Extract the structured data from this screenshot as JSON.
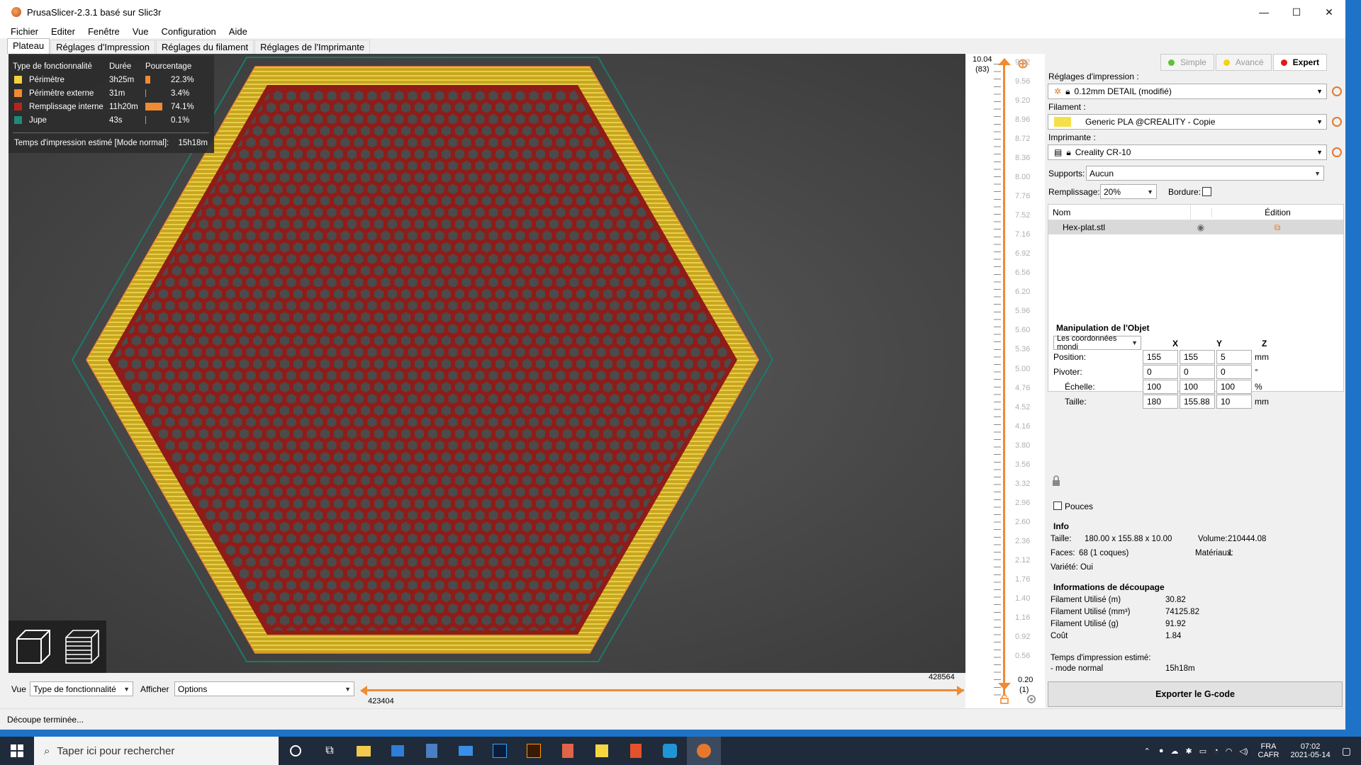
{
  "window": {
    "title": "PrusaSlicer-2.3.1 basé sur Slic3r",
    "controls": {
      "minimize": "—",
      "maximize": "☐",
      "close": "✕"
    }
  },
  "menu": [
    "Fichier",
    "Editer",
    "Fenêtre",
    "Vue",
    "Configuration",
    "Aide"
  ],
  "tabs": [
    "Plateau",
    "Réglages d'Impression",
    "Réglages du filament",
    "Réglages de l'Imprimante"
  ],
  "legend": {
    "headers": {
      "type": "Type de fonctionnalité",
      "duration": "Durée",
      "percent": "Pourcentage"
    },
    "rows": [
      {
        "name": "Périmètre",
        "duration": "3h25m",
        "percent": "22.3%",
        "fraction": 0.223,
        "color": "#f5d13b"
      },
      {
        "name": "Périmètre externe",
        "duration": "31m",
        "percent": "3.4%",
        "fraction": 0.034,
        "color": "#f08a33"
      },
      {
        "name": "Remplissage interne",
        "duration": "11h20m",
        "percent": "74.1%",
        "fraction": 0.741,
        "color": "#b3261e"
      },
      {
        "name": "Jupe",
        "duration": "43s",
        "percent": "0.1%",
        "fraction": 0.001,
        "color": "#1f8a7a"
      }
    ],
    "time_label": "Temps d'impression estimé [Mode normal]:",
    "time_value": "15h18m",
    "bar_color": "#f08a33"
  },
  "view_toolbar": {
    "icon_3d": "cube-icon",
    "icon_layers": "layers-icon"
  },
  "vertical_slider": {
    "top_value": "10.04",
    "top_layer": "(83)",
    "bottom_value": "0.20",
    "bottom_layer": "(1)",
    "ticks": [
      "9.92",
      "9.56",
      "9.20",
      "8.96",
      "8.72",
      "8.36",
      "8.00",
      "7.76",
      "7.52",
      "7.16",
      "6.92",
      "6.56",
      "6.20",
      "5.96",
      "5.60",
      "5.36",
      "5.00",
      "4.76",
      "4.52",
      "4.16",
      "3.80",
      "3.56",
      "3.32",
      "2.96",
      "2.60",
      "2.36",
      "2.12",
      "1.76",
      "1.40",
      "1.16",
      "0.92",
      "0.56"
    ],
    "accent": "#f08a33"
  },
  "bottom_bar": {
    "view_label": "Vue",
    "view_value": "Type de fonctionnalité",
    "show_label": "Afficher",
    "show_value": "Options",
    "slider_left": "423404",
    "slider_right": "428564"
  },
  "status": "Découpe terminée...",
  "sidebar": {
    "modes": [
      {
        "label": "Simple",
        "color": "#5fc234"
      },
      {
        "label": "Avancé",
        "color": "#f5d30e"
      },
      {
        "label": "Expert",
        "color": "#e01b1b"
      }
    ],
    "print_settings_label": "Réglages d'impression :",
    "print_settings_value": "0.12mm DETAIL (modifié)",
    "filament_label": "Filament :",
    "filament_value": "Generic PLA @CREALITY - Copie",
    "filament_color": "#f5e04a",
    "printer_label": "Imprimante :",
    "printer_value": "Creality CR-10",
    "supports_label": "Supports:",
    "supports_value": "Aucun",
    "infill_label": "Remplissage:",
    "infill_value": "20%",
    "brim_label": "Bordure:",
    "objects": {
      "col_name": "Nom",
      "col_edit": "Édition",
      "items": [
        {
          "name": "Hex-plat.stl"
        }
      ]
    },
    "manip": {
      "title": "Manipulation de l'Objet",
      "coord_mode": "Les coordonnées mondi",
      "axes": [
        "X",
        "Y",
        "Z"
      ],
      "rows": [
        {
          "label": "Position:",
          "values": [
            "155",
            "155",
            "5"
          ],
          "unit": "mm"
        },
        {
          "label": "Pivoter:",
          "values": [
            "0",
            "0",
            "0"
          ],
          "unit": "°"
        },
        {
          "label": "Échelle:",
          "values": [
            "100",
            "100",
            "100"
          ],
          "unit": "%"
        },
        {
          "label": "Taille:",
          "values": [
            "180",
            "155.88",
            "10"
          ],
          "unit": "mm"
        }
      ],
      "inches_label": "Pouces"
    },
    "info": {
      "title": "Info",
      "size_label": "Taille:",
      "size_value": "180.00 x 155.88 x 10.00",
      "volume_label": "Volume:",
      "volume_value": "210444.08",
      "faces_label": "Faces:",
      "faces_value": "68 (1 coques)",
      "materials_label": "Matériaux:",
      "materials_value": "1",
      "variety_label": "Variété: Oui"
    },
    "slice_info": {
      "title": "Informations de découpage",
      "rows": [
        {
          "label": "Filament Utilisé (m)",
          "value": "30.82"
        },
        {
          "label": "Filament Utilisé (mm³)",
          "value": "74125.82"
        },
        {
          "label": "Filament Utilisé (g)",
          "value": "91.92"
        },
        {
          "label": "Coût",
          "value": "1.84"
        }
      ],
      "time_label": "Temps d'impression estimé:",
      "time_sub": "- mode normal",
      "time_value": "15h18m"
    },
    "export_label": "Exporter le G-code"
  },
  "taskbar": {
    "search_placeholder": "Taper ici pour rechercher",
    "lang_top": "FRA",
    "lang_bottom": "CAFR",
    "time": "07:02",
    "date": "2021-05-14"
  }
}
